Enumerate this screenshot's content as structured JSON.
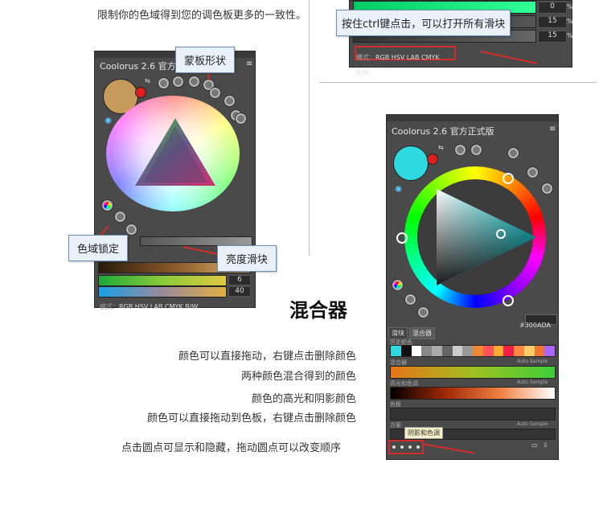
{
  "top_text": "限制你的色域得到您的调色板更多的一致性。",
  "tip_ctrl": "按住ctrl键点击，可以打开所有滑块",
  "top_right_panel": {
    "values": [
      "0",
      "15",
      "15"
    ],
    "percent": "%",
    "mode_label": "模式：",
    "modes": "RGB HSV LAB CMYK B/W"
  },
  "left_panel": {
    "title": "Coolorus 2.6 官方正式",
    "menu_icon": "≡",
    "values": [
      "6",
      "40"
    ],
    "mode_label": "模式：",
    "modes": "RGB HSV LAB CMYK B/W",
    "swatch_color": "#c69a5a",
    "wheel_center": "#5a4a6a"
  },
  "callouts": {
    "mask_shape": "蒙板形状",
    "gamut_lock": "色域锁定",
    "brightness_slider": "亮度滑块"
  },
  "right_panel": {
    "title": "Coolorus 2.6 官方正式版",
    "menu_icon": "≡",
    "hex_label": "#",
    "hex_value": "300ADA",
    "swatch_color": "#2ed9df",
    "tabs": [
      "滑块",
      "混合器"
    ],
    "section_history": "历史颜色",
    "section_mixer": "混合器",
    "section_highlight": "高光和色调",
    "section_palette": "色板",
    "section_plan": "方案",
    "auto_sample": "Auto Sample",
    "tooltip": "阴影和色调"
  },
  "heading_mixer": "混合器",
  "notes": [
    "颜色可以直接拖动，右键点击删除颜色",
    "两种颜色混合得到的颜色",
    "颜色的高光和阴影颜色",
    "颜色可以直接拖动到色板，右键点击删除颜色"
  ],
  "bottom_note": "点击圆点可显示和隐藏，拖动圆点可以改变顺序"
}
